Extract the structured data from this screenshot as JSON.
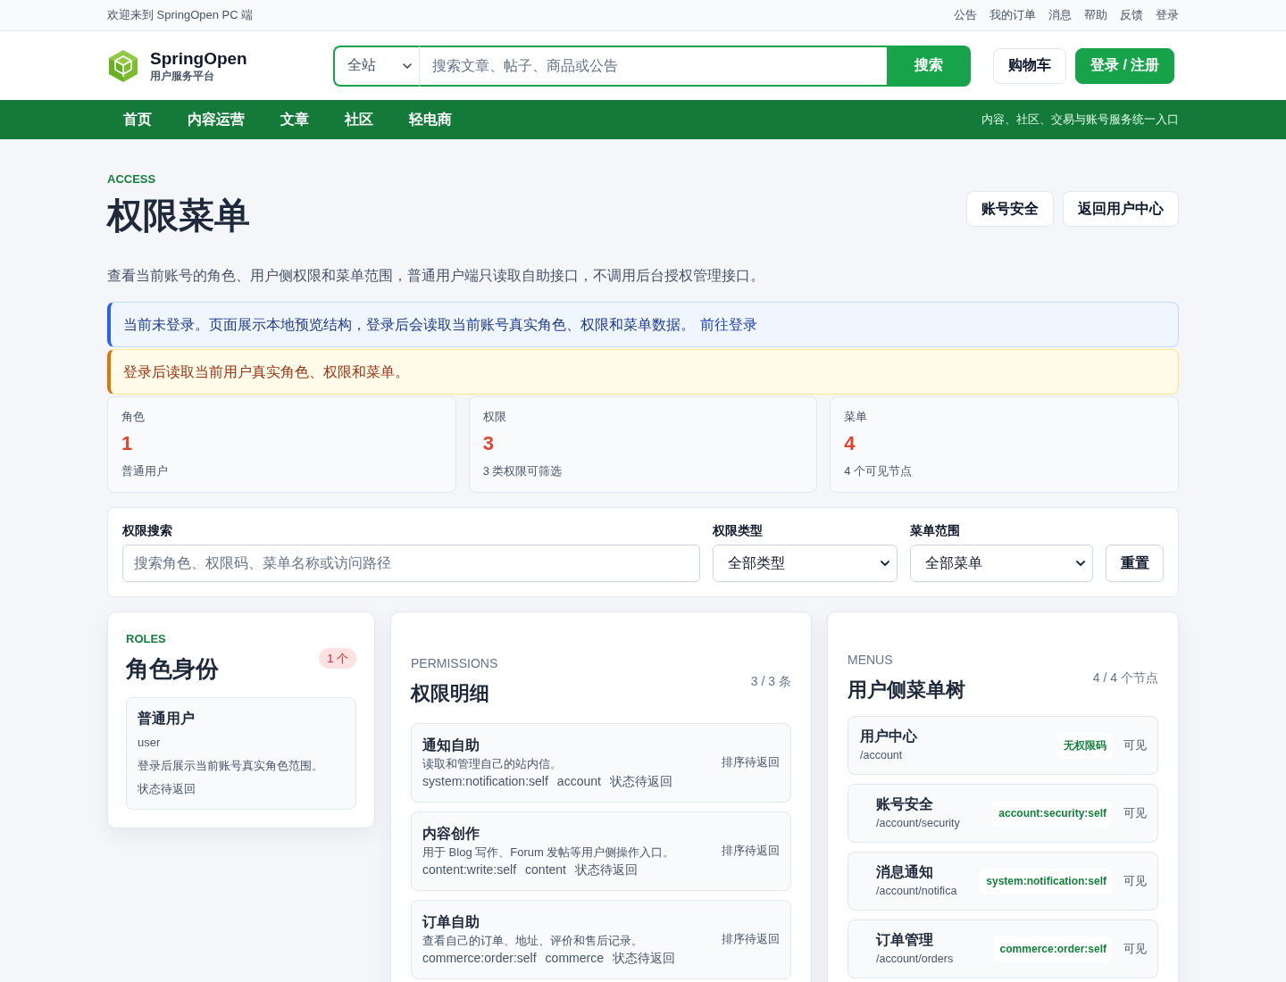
{
  "top_bar": {
    "welcome": "欢迎来到 SpringOpen PC 端",
    "links": [
      "公告",
      "我的订单",
      "消息",
      "帮助",
      "反馈",
      "登录"
    ]
  },
  "header": {
    "brand": {
      "name": "SpringOpen",
      "subtitle": "用户服务平台"
    },
    "search": {
      "scope": "全站",
      "placeholder": "搜索文章、帖子、商品或公告",
      "button": "搜索"
    },
    "buttons": [
      {
        "label": "购物车",
        "kind": "secondary"
      },
      {
        "label": "登录 / 注册",
        "kind": "primary"
      }
    ]
  },
  "nav": {
    "items": [
      "首页",
      "内容运营",
      "文章",
      "社区",
      "轻电商"
    ],
    "tagline": "内容、社区、交易与账号服务统一入口"
  },
  "page": {
    "eyebrow": "ACCESS",
    "title": "权限菜单",
    "actions": [
      "账号安全",
      "返回用户中心"
    ],
    "description": "查看当前账号的角色、用户侧权限和菜单范围，普通用户端只读取自助接口，不调用后台授权管理接口。"
  },
  "alerts": [
    {
      "kind": "info",
      "text": "当前未登录。页面展示本地预览结构，登录后会读取当前账号真实角色、权限和菜单数据。",
      "link": "前往登录"
    },
    {
      "kind": "warning",
      "text": "登录后读取当前用户真实角色、权限和菜单。"
    }
  ],
  "stats": [
    {
      "label": "角色",
      "value": "1",
      "note": "普通用户"
    },
    {
      "label": "权限",
      "value": "3",
      "note": "3 类权限可筛选"
    },
    {
      "label": "菜单",
      "value": "4",
      "note": "4 个可见节点"
    }
  ],
  "filters": {
    "search": {
      "label": "权限搜索",
      "placeholder": "搜索角色、权限码、菜单名称或访问路径"
    },
    "type": {
      "label": "权限类型",
      "value": "全部类型"
    },
    "menu_scope": {
      "label": "菜单范围",
      "value": "全部菜单"
    },
    "reset": "重置"
  },
  "roles": {
    "eyebrow": "ROLES",
    "title": "角色身份",
    "count": "1 个",
    "items": [
      {
        "name": "普通用户",
        "code": "user",
        "description": "登录后展示当前账号真实角色范围。",
        "status": "状态待返回"
      }
    ]
  },
  "permissions": {
    "eyebrow": "PERMISSIONS",
    "title": "权限明细",
    "count": "3 / 3 条",
    "items": [
      {
        "name": "通知自助",
        "description": "读取和管理自己的站内信。",
        "code": "system:notification:self",
        "module": "account",
        "status": "状态待返回",
        "sort": "排序待返回"
      },
      {
        "name": "内容创作",
        "description": "用于 Blog 写作、Forum 发帖等用户侧操作入口。",
        "code": "content:write:self",
        "module": "content",
        "status": "状态待返回",
        "sort": "排序待返回"
      },
      {
        "name": "订单自助",
        "description": "查看自己的订单、地址、评价和售后记录。",
        "code": "commerce:order:self",
        "module": "commerce",
        "status": "状态待返回",
        "sort": "排序待返回"
      }
    ]
  },
  "menus": {
    "eyebrow": "MENUS",
    "title": "用户侧菜单树",
    "count": "4 / 4 个节点",
    "items": [
      {
        "name": "用户中心",
        "path": "/account",
        "permission": "无权限码",
        "visibility": "可见",
        "children": [
          {
            "name": "账号安全",
            "path": "/account/security",
            "permission": "account:security:self",
            "visibility": "可见"
          },
          {
            "name": "消息通知",
            "path": "/account/notifica",
            "permission": "system:notification:self",
            "visibility": "可见"
          },
          {
            "name": "订单管理",
            "path": "/account/orders",
            "permission": "commerce:order:self",
            "visibility": "可见"
          }
        ]
      }
    ]
  }
}
